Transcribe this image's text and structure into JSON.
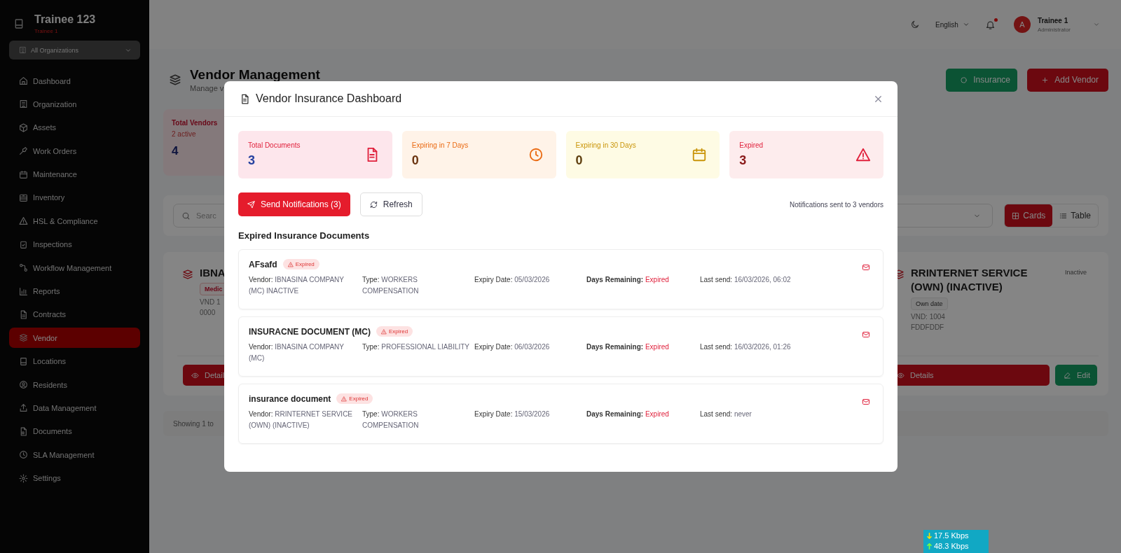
{
  "sidebar": {
    "brand": "Trainee 123",
    "subtitle": "Trainee 1",
    "org_select": "All Organizations",
    "items": [
      {
        "label": "Dashboard",
        "selected": false
      },
      {
        "label": "Organization",
        "selected": false
      },
      {
        "label": "Assets",
        "selected": false
      },
      {
        "label": "Work Orders",
        "selected": false
      },
      {
        "label": "Maintenance",
        "selected": false
      },
      {
        "label": "Inventory",
        "selected": false
      },
      {
        "label": "HSL & Compliance",
        "selected": false
      },
      {
        "label": "Inspections",
        "selected": false
      },
      {
        "label": "Workflow Management",
        "selected": false
      },
      {
        "label": "Reports",
        "selected": false
      },
      {
        "label": "Contracts",
        "selected": false
      },
      {
        "label": "Vendor",
        "selected": true
      },
      {
        "label": "Locations",
        "selected": false
      },
      {
        "label": "Residents",
        "selected": false
      },
      {
        "label": "Data Management",
        "selected": false
      },
      {
        "label": "Documents",
        "selected": false
      },
      {
        "label": "SLA Management",
        "selected": false
      },
      {
        "label": "Settings",
        "selected": false
      }
    ]
  },
  "header": {
    "language": "English",
    "notification_dot": true,
    "user_initial": "A",
    "user_name": "Trainee 1",
    "user_role": "Administrator"
  },
  "page": {
    "title": "Vendor Management",
    "subtitle": "Manage v",
    "buttons": [
      {
        "label": "Insurance",
        "kind": "insurance"
      },
      {
        "label": "Add Vendor",
        "kind": "add"
      }
    ],
    "stats_card": {
      "label": "Total Vendors",
      "note": "2 active",
      "value": "4"
    },
    "search_placeholder": "Searc",
    "view_toggle": [
      {
        "label": "Cards",
        "selected": true
      },
      {
        "label": "Table",
        "selected": false
      }
    ],
    "vendor_cards": [
      {
        "name": "IBNA",
        "tag": "Medic",
        "code": "VND 1",
        "line": "0000",
        "buttons": [
          {
            "label": "Detail",
            "kind": "details"
          }
        ]
      },
      {
        "name": "RRINTERNET SERVICE (OWN) (INACTIVE)",
        "status": "Inactive",
        "tag": "Own date",
        "code": "VND: 1004",
        "line": "FDDFDDF",
        "buttons": [
          {
            "label": "Details",
            "kind": "details"
          },
          {
            "label": "Edit",
            "kind": "edit"
          }
        ]
      }
    ],
    "footer_text": "Showing 1 to"
  },
  "modal": {
    "title": "Vendor Insurance Dashboard",
    "stats": [
      {
        "kind": "total",
        "label": "Total Documents",
        "value": "3"
      },
      {
        "kind": "week",
        "label": "Expiring in 7 Days",
        "value": "0"
      },
      {
        "kind": "month",
        "label": "Expiring in 30 Days",
        "value": "0"
      },
      {
        "kind": "expired",
        "label": "Expired",
        "value": "3"
      }
    ],
    "send_button": "Send Notifications (3)",
    "refresh_button": "Refresh",
    "notice": "Notifications sent to 3 vendors",
    "section_title": "Expired Insurance Documents",
    "documents": [
      {
        "title": "AFsafd",
        "badge": "Expired",
        "fields": [
          {
            "label": "Vendor:",
            "value": "IBNASINA COMPANY (MC) INACTIVE",
            "kind": "text"
          },
          {
            "label": "Type:",
            "value": "WORKERS COMPENSATION",
            "kind": "text"
          },
          {
            "label": "Expiry Date:",
            "value": "05/03/2026",
            "kind": "text"
          },
          {
            "label": "Days Remaining:",
            "value": "Expired",
            "kind": "status"
          },
          {
            "label": "Last send:",
            "value": "16/03/2026, 06:02",
            "kind": "text"
          }
        ]
      },
      {
        "title": "INSURACNE DOCUMENT (MC)",
        "badge": "Expired",
        "fields": [
          {
            "label": "Vendor:",
            "value": "IBNASINA COMPANY (MC)",
            "kind": "text"
          },
          {
            "label": "Type:",
            "value": "PROFESSIONAL LIABILITY",
            "kind": "text"
          },
          {
            "label": "Expiry Date:",
            "value": "06/03/2026",
            "kind": "text"
          },
          {
            "label": "Days Remaining:",
            "value": "Expired",
            "kind": "status"
          },
          {
            "label": "Last send:",
            "value": "16/03/2026, 01:26",
            "kind": "text"
          }
        ]
      },
      {
        "title": "insurance document",
        "badge": "Expired",
        "fields": [
          {
            "label": "Vendor:",
            "value": "RRINTERNET SERVICE (OWN) (INACTIVE)",
            "kind": "text"
          },
          {
            "label": "Type:",
            "value": "WORKERS COMPENSATION",
            "kind": "text"
          },
          {
            "label": "Expiry Date:",
            "value": "15/03/2026",
            "kind": "text"
          },
          {
            "label": "Days Remaining:",
            "value": "Expired",
            "kind": "status"
          },
          {
            "label": "Last send:",
            "value": "never",
            "kind": "text"
          }
        ]
      }
    ]
  },
  "network_meter": {
    "down": "17.5 Kbps",
    "up": "48.3 Kbps"
  }
}
